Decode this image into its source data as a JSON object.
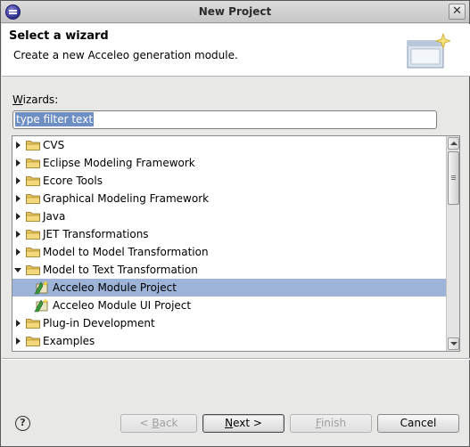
{
  "window": {
    "title": "New Project",
    "close_glyph": "✕"
  },
  "banner": {
    "title": "Select a wizard",
    "description": "Create a new Acceleo generation module."
  },
  "wizards": {
    "label_mnemonic": "W",
    "label_rest": "izards:",
    "filter_value": "type filter text"
  },
  "tree": {
    "items": [
      {
        "label": "CVS",
        "kind": "folder",
        "expanded": false,
        "depth": 0
      },
      {
        "label": "Eclipse Modeling Framework",
        "kind": "folder",
        "expanded": false,
        "depth": 0
      },
      {
        "label": "Ecore Tools",
        "kind": "folder",
        "expanded": false,
        "depth": 0
      },
      {
        "label": "Graphical Modeling Framework",
        "kind": "folder",
        "expanded": false,
        "depth": 0
      },
      {
        "label": "Java",
        "kind": "folder",
        "expanded": false,
        "depth": 0
      },
      {
        "label": "JET Transformations",
        "kind": "folder",
        "expanded": false,
        "depth": 0
      },
      {
        "label": "Model to Model Transformation",
        "kind": "folder",
        "expanded": false,
        "depth": 0
      },
      {
        "label": "Model to Text Transformation",
        "kind": "folder",
        "expanded": true,
        "depth": 0
      },
      {
        "label": "Acceleo Module Project",
        "kind": "project",
        "selected": true,
        "depth": 1
      },
      {
        "label": "Acceleo Module UI Project",
        "kind": "project",
        "selected": false,
        "depth": 1
      },
      {
        "label": "Plug-in Development",
        "kind": "folder",
        "expanded": false,
        "depth": 0
      },
      {
        "label": "Examples",
        "kind": "folder",
        "expanded": false,
        "depth": 0
      }
    ]
  },
  "buttons": {
    "help_glyph": "?",
    "back_prefix": "< ",
    "back_mnemonic": "B",
    "back_rest": "ack",
    "next_mnemonic": "N",
    "next_rest": "ext >",
    "finish_mnemonic": "F",
    "finish_rest": "inish",
    "cancel": "Cancel"
  },
  "colors": {
    "selection": "#9db3d8",
    "folder": "#e8c45c"
  }
}
